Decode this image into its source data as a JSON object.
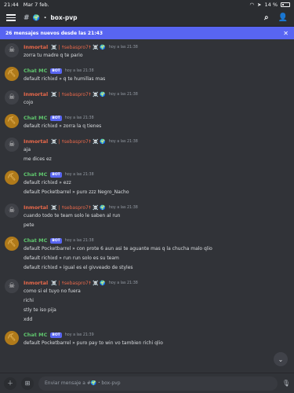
{
  "status_bar": {
    "time": "21:44",
    "date": "Mar 7 feb.",
    "battery": "14 %"
  },
  "header": {
    "channel": "box-pvp",
    "channel_emoji": "🌍"
  },
  "banner": {
    "text": "26 mensajes nuevos desde las 21:43",
    "close": "✕"
  },
  "messages": [
    {
      "type": "user",
      "author": "Inmortal",
      "deco": "☠️ | ☨sebaspro7☨ ☠️ 🌍",
      "time": "hoy a las 21:38",
      "lines": [
        "zorra tu madre q te pario"
      ]
    },
    {
      "type": "bot",
      "author": "Chat MC",
      "tag": "BOT",
      "time": "hoy a las 21:38",
      "lines": [
        "default richixd » q te humillas mas"
      ]
    },
    {
      "type": "user",
      "author": "Inmortal",
      "deco": "☠️ | ☨sebaspro7☨ ☠️ 🌍",
      "time": "hoy a las 21:38",
      "lines": [
        "cojo"
      ]
    },
    {
      "type": "bot",
      "author": "Chat MC",
      "tag": "BOT",
      "time": "hoy a las 21:38",
      "lines": [
        "default richixd » zorra la q tienes"
      ]
    },
    {
      "type": "user",
      "author": "Inmortal",
      "deco": "☠️ | ☨sebaspro7☨ ☠️ 🌍",
      "time": "hoy a las 21:38",
      "lines": [
        "aja",
        "me dices ez"
      ]
    },
    {
      "type": "bot",
      "author": "Chat MC",
      "tag": "BOT",
      "time": "hoy a las 21:38",
      "lines": [
        "default richixd » ezz",
        "default Pocketbarrel » puro zzz Negro_Nacho"
      ]
    },
    {
      "type": "user",
      "author": "Inmortal",
      "deco": "☠️ | ☨sebaspro7☨ ☠️ 🌍",
      "time": "hoy a las 21:38",
      "lines": [
        "cuando todo te team solo le saben al run",
        "pete"
      ]
    },
    {
      "type": "bot",
      "author": "Chat MC",
      "tag": "BOT",
      "time": "hoy a las 21:38",
      "lines": [
        "default Pocketbarrel » con prote 6 aun asi te aguante mas q la chucha malo qlio",
        "default richixd » run run solo es su team",
        "default richixd » igual es el givveado de styles"
      ]
    },
    {
      "type": "user",
      "author": "Inmortal",
      "deco": "☠️ | ☨sebaspro7☨ ☠️ 🌍",
      "time": "hoy a las 21:38",
      "lines": [
        "como si el tuyo no fuera",
        "richi",
        "stly te iso pija",
        "xdd"
      ]
    },
    {
      "type": "bot",
      "author": "Chat MC",
      "tag": "BOT",
      "time": "hoy a las 21:39",
      "lines": [
        "default Pocketbarrel » puro pay to win vo tambien richi qlio"
      ]
    }
  ],
  "composer": {
    "placeholder": "Enviar mensaje a #🌍・box-pvp"
  }
}
